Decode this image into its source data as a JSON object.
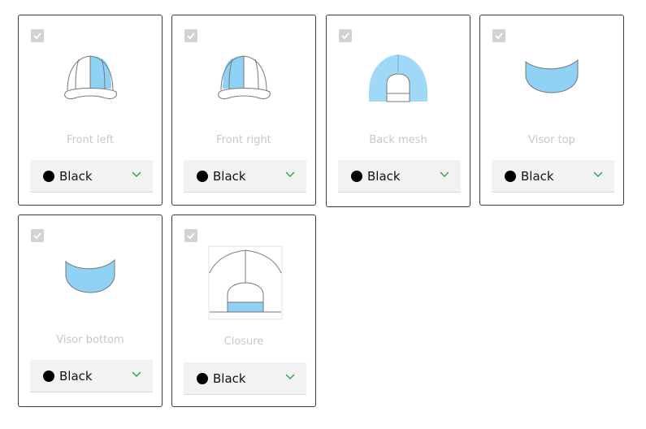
{
  "colors": {
    "highlight": "#8fd2f6",
    "swatch": "#000000",
    "chevron": "#2e9e48"
  },
  "cards": [
    {
      "id": "front-left",
      "label": "Front left",
      "checked": true,
      "color": "Black",
      "icon": "cap-front-left-icon"
    },
    {
      "id": "front-right",
      "label": "Front right",
      "checked": true,
      "color": "Black",
      "icon": "cap-front-right-icon"
    },
    {
      "id": "back-mesh",
      "label": "Back mesh",
      "checked": true,
      "color": "Black",
      "icon": "cap-back-mesh-icon"
    },
    {
      "id": "visor-top",
      "label": "Visor top",
      "checked": true,
      "color": "Black",
      "icon": "visor-top-icon"
    },
    {
      "id": "visor-bottom",
      "label": "Visor bottom",
      "checked": true,
      "color": "Black",
      "icon": "visor-bottom-icon"
    },
    {
      "id": "closure",
      "label": "Closure",
      "checked": true,
      "color": "Black",
      "icon": "cap-closure-icon"
    }
  ]
}
